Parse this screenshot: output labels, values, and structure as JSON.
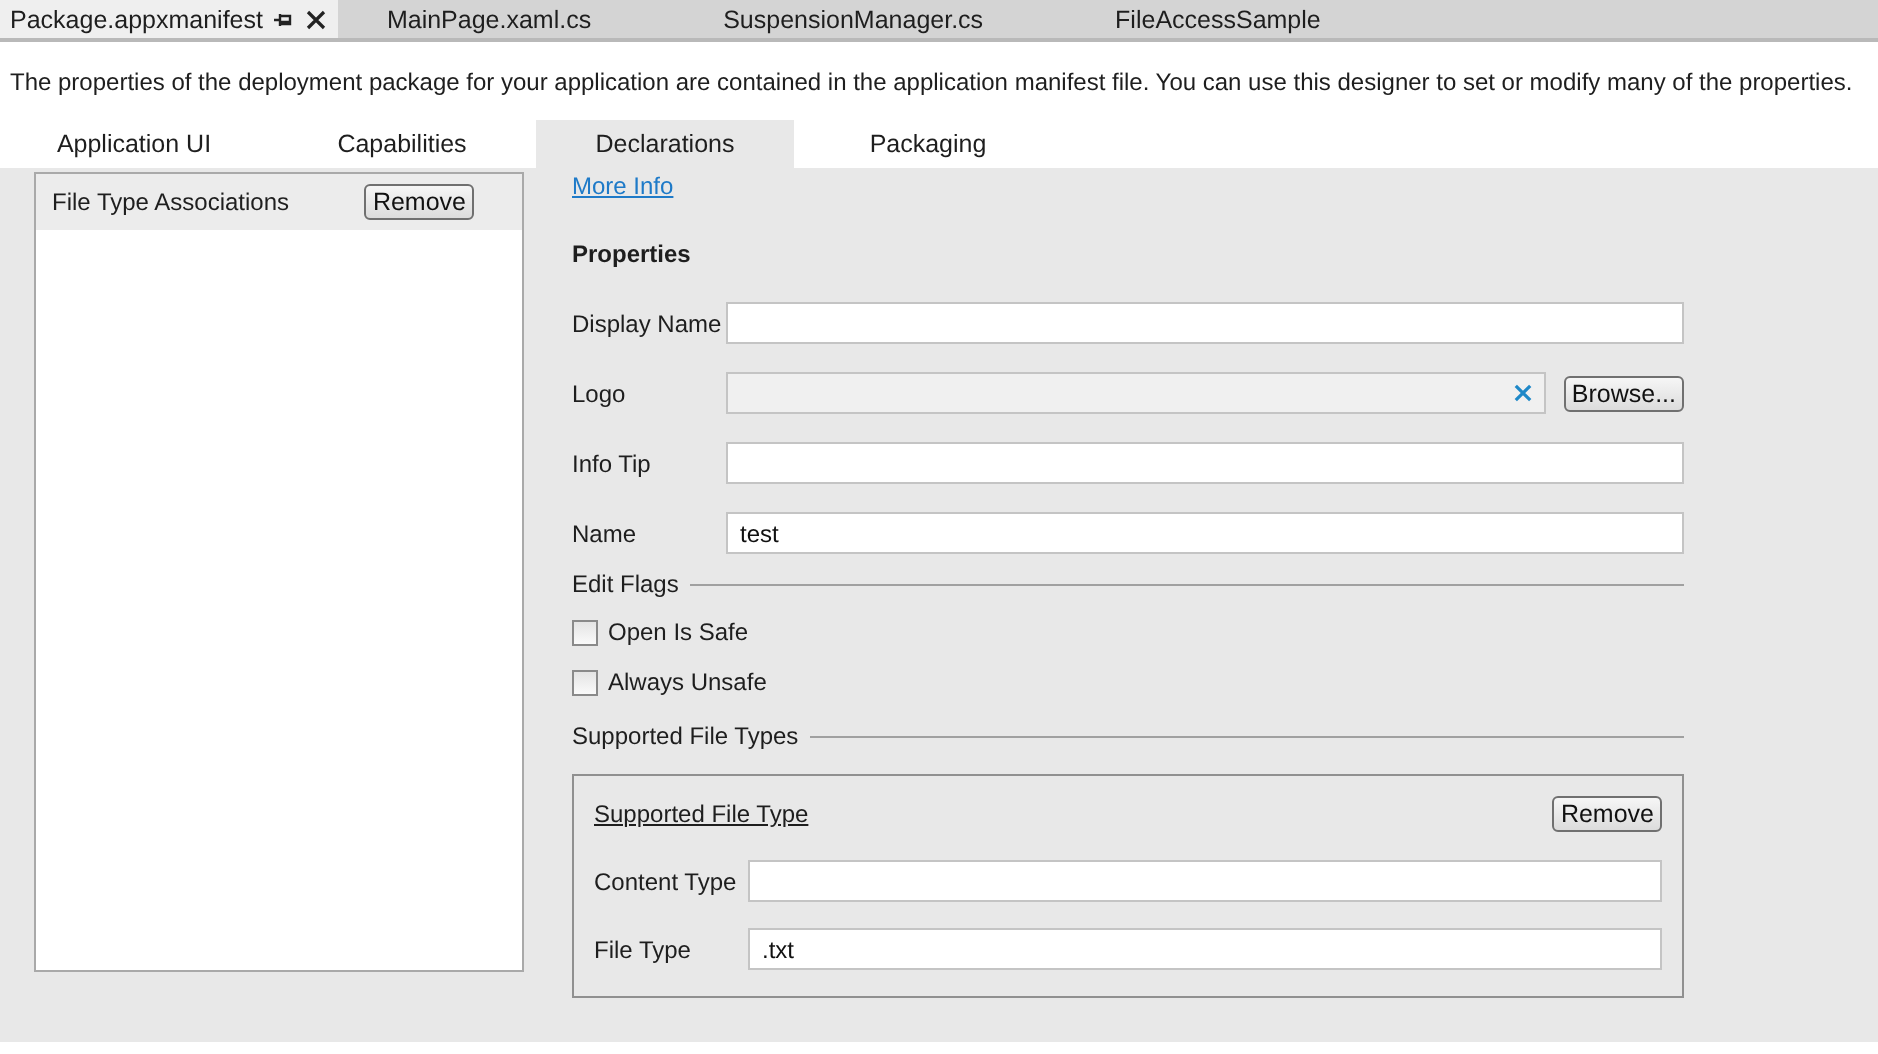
{
  "document_tabs": [
    {
      "label": "Package.appxmanifest",
      "selected": true
    },
    {
      "label": "MainPage.xaml.cs",
      "selected": false
    },
    {
      "label": "SuspensionManager.cs",
      "selected": false
    },
    {
      "label": "FileAccessSample",
      "selected": false
    }
  ],
  "description": "The properties of the deployment package for your application are contained in the application manifest file. You can use this designer to set or modify many of the properties.",
  "tabs": [
    {
      "label": "Application UI",
      "selected": false
    },
    {
      "label": "Capabilities",
      "selected": false
    },
    {
      "label": "Declarations",
      "selected": true
    },
    {
      "label": "Packaging",
      "selected": false
    }
  ],
  "declarations": {
    "items": [
      {
        "label": "File Type Associations",
        "selected": true,
        "button": "Remove"
      }
    ]
  },
  "details": {
    "link": "More Info",
    "heading": "Properties",
    "fields": [
      {
        "kind": "text",
        "label": "Display Name"
      },
      {
        "kind": "file",
        "label": "Logo",
        "button": "Browse..."
      },
      {
        "kind": "text",
        "label": "Info Tip"
      },
      {
        "kind": "text",
        "label": "Name",
        "value": "test"
      }
    ],
    "edit_flags": {
      "title": "Edit Flags",
      "options": [
        {
          "label": "Open Is Safe",
          "checked": false
        },
        {
          "label": "Always Unsafe",
          "checked": false
        }
      ]
    },
    "supported_file_types": {
      "title": "Supported File Types",
      "entries": [
        {
          "title": "Supported File Type",
          "button": "Remove",
          "fields": [
            {
              "label": "Content Type"
            },
            {
              "label": "File Type",
              "value": ".txt"
            }
          ]
        }
      ]
    }
  }
}
